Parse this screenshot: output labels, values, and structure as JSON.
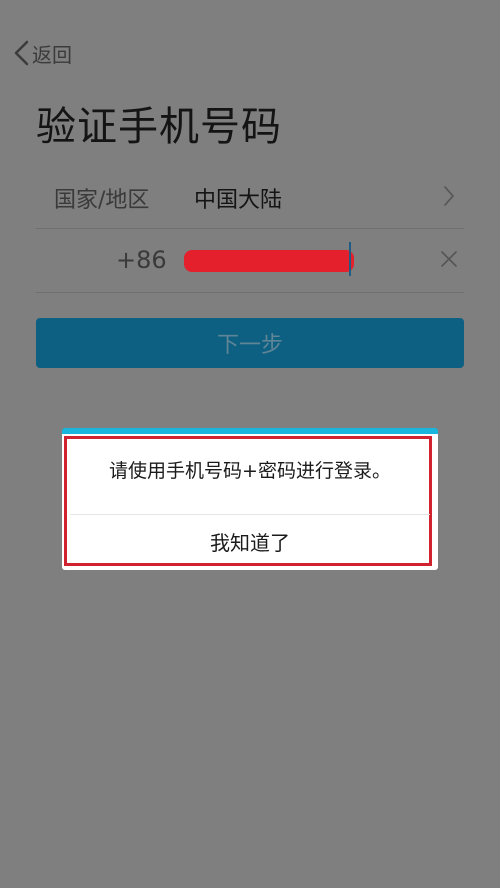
{
  "header": {
    "back_label": "返回"
  },
  "page": {
    "title": "验证手机号码"
  },
  "region": {
    "label": "国家/地区",
    "value": "中国大陆"
  },
  "phone": {
    "country_code": "+86"
  },
  "actions": {
    "next_label": "下一步"
  },
  "dialog": {
    "message": "请使用手机号码+密码进行登录。",
    "confirm_label": "我知道了"
  },
  "icons": {
    "back": "chevron-left-icon",
    "region_arrow": "chevron-right-icon",
    "clear": "close-icon"
  },
  "colors": {
    "overlay_background": "#7f7f7f",
    "primary_button": "#0d6082",
    "dialog_accent": "#19b5dc",
    "annotation_red": "#d0232f",
    "redaction_red": "#e3202c"
  }
}
